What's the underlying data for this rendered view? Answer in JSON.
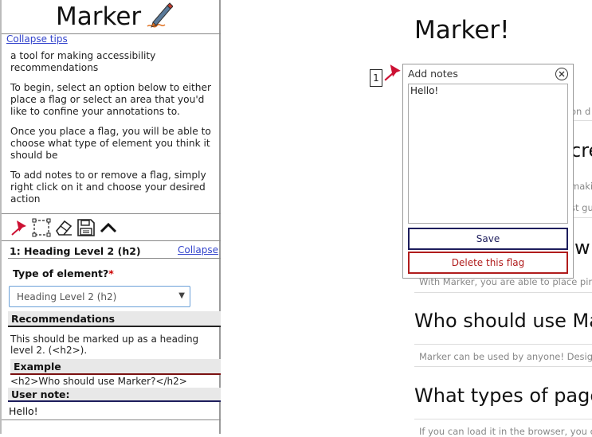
{
  "sidebar": {
    "logo_text": "Marker",
    "collapse_tips": "Collapse tips",
    "tips": [
      "a tool for making accessibility recommendations",
      "To begin, select an option below to either place a flag or select an area that you'd like to confine your annotations to.",
      "Once you place a flag, you will be able to choose what type of element you think it should be",
      "To add notes to or remove a flag, simply right click on it and choose your desired action"
    ],
    "toolbar": [
      "pin-icon",
      "select-area-icon",
      "eraser-icon",
      "save-icon",
      "chevron-up-icon"
    ],
    "flag": {
      "title": "1:  Heading Level 2 (h2)",
      "collapse": "Collapse",
      "type_label": "Type of element?",
      "required_mark": "*",
      "select_value": "Heading Level 2 (h2)",
      "recommendations_heading": "Recommendations",
      "recommendation_text": "This should be marked up as a heading level 2. (<h2>).",
      "example_heading": "Example",
      "example_code": "<h2>Who should use Marker?</h2>",
      "user_note_heading": "User note:",
      "user_note_text": "Hello!"
    }
  },
  "page": {
    "title": "Marker!",
    "marker_number": "1",
    "fragments": [
      {
        "kind": "p",
        "text": "on d"
      },
      {
        "kind": "h2",
        "text": "cre"
      },
      {
        "kind": "p",
        "text": "makin"
      },
      {
        "kind": "p",
        "text": "st gu"
      },
      {
        "kind": "h2",
        "text": "w"
      },
      {
        "kind": "p",
        "text": "With Marker, you are able to place pins"
      },
      {
        "kind": "h2",
        "text": "Who should use Ma"
      },
      {
        "kind": "p",
        "text": "Marker can be used by anyone! Designe"
      },
      {
        "kind": "h2",
        "text": "What types of pages"
      },
      {
        "kind": "p",
        "text": "If you can load it in the browser, you ca"
      }
    ]
  },
  "popup": {
    "title": "Add notes",
    "textarea_value": "Hello!",
    "save_label": "Save",
    "delete_label": "Delete this flag"
  },
  "colors": {
    "link": "#3344cc",
    "save_border": "#1d1d5c",
    "delete_border": "#b01c1c",
    "pin": "#cc1133",
    "required": "#cc0000"
  }
}
